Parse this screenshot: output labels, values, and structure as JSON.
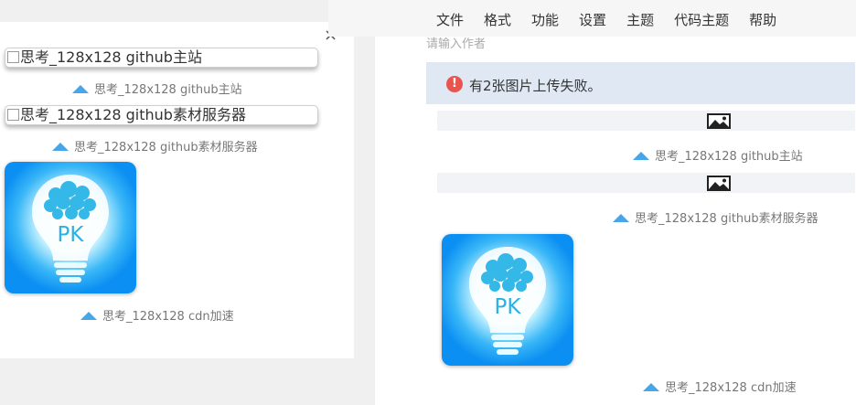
{
  "left_panel": {
    "close_symbol": "×",
    "images": [
      {
        "alt": "思考_128x128 github主站",
        "caption": "思考_128x128 github主站"
      },
      {
        "alt": "思考_128x128 github素材服务器",
        "caption": "思考_128x128 github素材服务器"
      }
    ],
    "logo_text": "PK",
    "logo_caption": "思考_128x128 cdn加速"
  },
  "menu": {
    "items": [
      "文件",
      "格式",
      "功能",
      "设置",
      "主题",
      "代码主题",
      "帮助"
    ]
  },
  "editor": {
    "author_placeholder": "请输入作者",
    "alert_symbol": "!",
    "alert_text": "有2张图片上传失败。",
    "captions": [
      "思考_128x128 github主站",
      "思考_128x128 github素材服务器"
    ],
    "logo_caption": "思考_128x128 cdn加速"
  },
  "colors": {
    "alert_bg": "#dfe8f3",
    "alert_icon": "#e8554e",
    "caption_triangle": "#46a6e8",
    "logo_blue": "#0b8ff2"
  }
}
